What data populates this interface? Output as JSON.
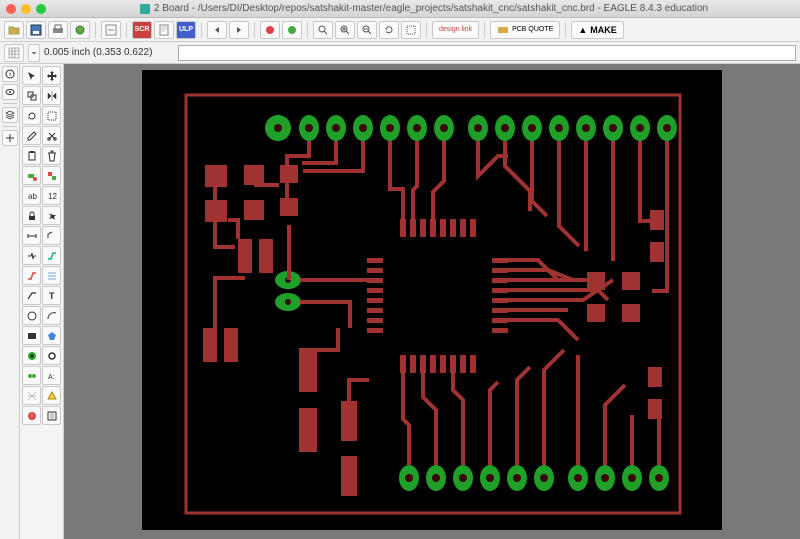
{
  "app": {
    "title": "2 Board - /Users/DI/Desktop/repos/satshakit-master/eagle_projects/satshakit_cnc/satshakit_cnc.brd - EAGLE 8.4.3 education",
    "name": "EAGLE"
  },
  "toolbar": {
    "design_link": "design link",
    "pcb_quote": "PCB QUOTE",
    "make": "MAKE"
  },
  "coords": "0.005 inch (0.353 0.622)",
  "cmd_placeholder": "",
  "icons": {
    "open": "open",
    "save": "save",
    "print": "print",
    "cam": "cam",
    "schematic": "schematic",
    "scr": "SCR",
    "letter": "letter",
    "ulp_blue": "ulp",
    "undo": "undo",
    "redo": "redo",
    "cancel": "cancel",
    "go": "go",
    "zoom_fit": "zoom-fit",
    "zoom_in": "zoom-in",
    "zoom_out": "zoom-out",
    "zoom_sel": "zoom-selection",
    "zoom_redraw": "redraw"
  },
  "sidebar_icons": [
    "eye",
    "info",
    "layers",
    "grid",
    "select",
    "move",
    "copy",
    "mirror",
    "rotate",
    "group",
    "change",
    "cut",
    "paste",
    "delete",
    "add",
    "name",
    "value",
    "smash",
    "miter",
    "split",
    "route",
    "ripup",
    "wire",
    "text",
    "circle",
    "arc",
    "rect",
    "polygon",
    "via",
    "hole",
    "dimension",
    "ratsnest",
    "drc",
    "errors",
    "mark"
  ],
  "board": {
    "trace_color": "#a03232",
    "pad_green": "#1fa028",
    "pad_hole": "#3a0808"
  }
}
